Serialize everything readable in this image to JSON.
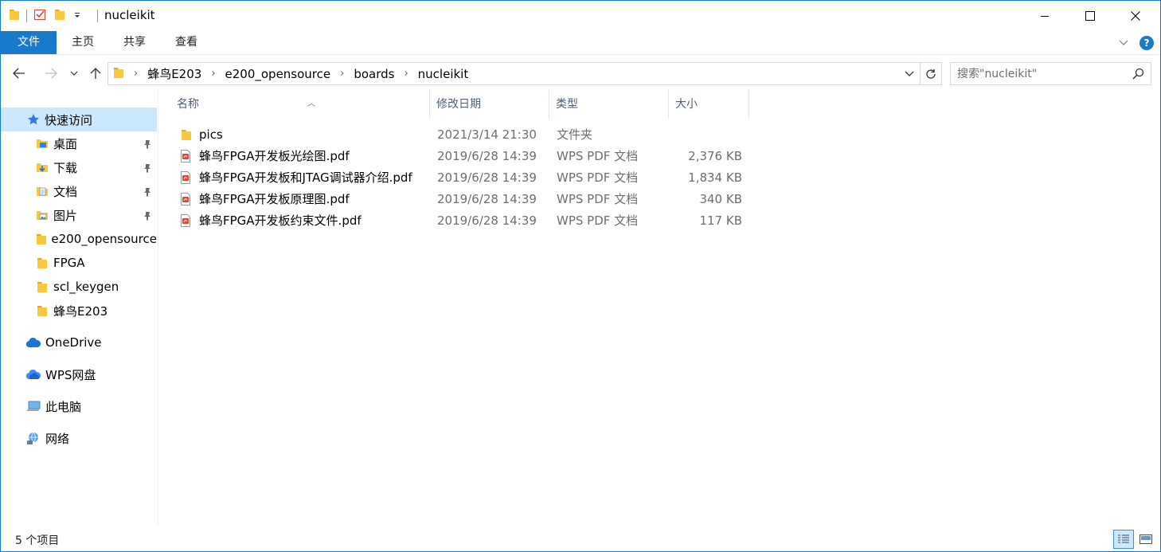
{
  "window": {
    "title": "nucleikit"
  },
  "ribbon": {
    "tabs": [
      "文件",
      "主页",
      "共享",
      "查看"
    ]
  },
  "address": {
    "crumbs": [
      "蜂鸟E203",
      "e200_opensource",
      "boards",
      "nucleikit"
    ],
    "search_placeholder": "搜索\"nucleikit\""
  },
  "sidebar": {
    "quick_access": "快速访问",
    "items": [
      {
        "label": "桌面",
        "pinned": true,
        "icon": "desktop-folder-icon"
      },
      {
        "label": "下载",
        "pinned": true,
        "icon": "downloads-folder-icon"
      },
      {
        "label": "文档",
        "pinned": true,
        "icon": "documents-folder-icon"
      },
      {
        "label": "图片",
        "pinned": true,
        "icon": "pictures-folder-icon"
      },
      {
        "label": "e200_opensource",
        "pinned": false,
        "icon": "folder-icon"
      },
      {
        "label": "FPGA",
        "pinned": false,
        "icon": "folder-icon"
      },
      {
        "label": "scl_keygen",
        "pinned": false,
        "icon": "folder-icon"
      },
      {
        "label": "蜂鸟E203",
        "pinned": false,
        "icon": "folder-icon"
      }
    ],
    "onedrive": "OneDrive",
    "wps": "WPS网盘",
    "this_pc": "此电脑",
    "network": "网络"
  },
  "columns": {
    "name": "名称",
    "date": "修改日期",
    "type": "类型",
    "size": "大小"
  },
  "files": [
    {
      "name": "pics",
      "date": "2021/3/14 21:30",
      "type": "文件夹",
      "size": "",
      "kind": "folder"
    },
    {
      "name": "蜂鸟FPGA开发板光绘图.pdf",
      "date": "2019/6/28 14:39",
      "type": "WPS PDF 文档",
      "size": "2,376 KB",
      "kind": "pdf"
    },
    {
      "name": "蜂鸟FPGA开发板和JTAG调试器介绍.pdf",
      "date": "2019/6/28 14:39",
      "type": "WPS PDF 文档",
      "size": "1,834 KB",
      "kind": "pdf"
    },
    {
      "name": "蜂鸟FPGA开发板原理图.pdf",
      "date": "2019/6/28 14:39",
      "type": "WPS PDF 文档",
      "size": "340 KB",
      "kind": "pdf"
    },
    {
      "name": "蜂鸟FPGA开发板约束文件.pdf",
      "date": "2019/6/28 14:39",
      "type": "WPS PDF 文档",
      "size": "117 KB",
      "kind": "pdf"
    }
  ],
  "status": {
    "count": "5 个项目"
  },
  "colors": {
    "accent": "#1979ca",
    "selection": "#cce8ff",
    "folder": "#f8c840",
    "pdf": "#e0453a"
  }
}
